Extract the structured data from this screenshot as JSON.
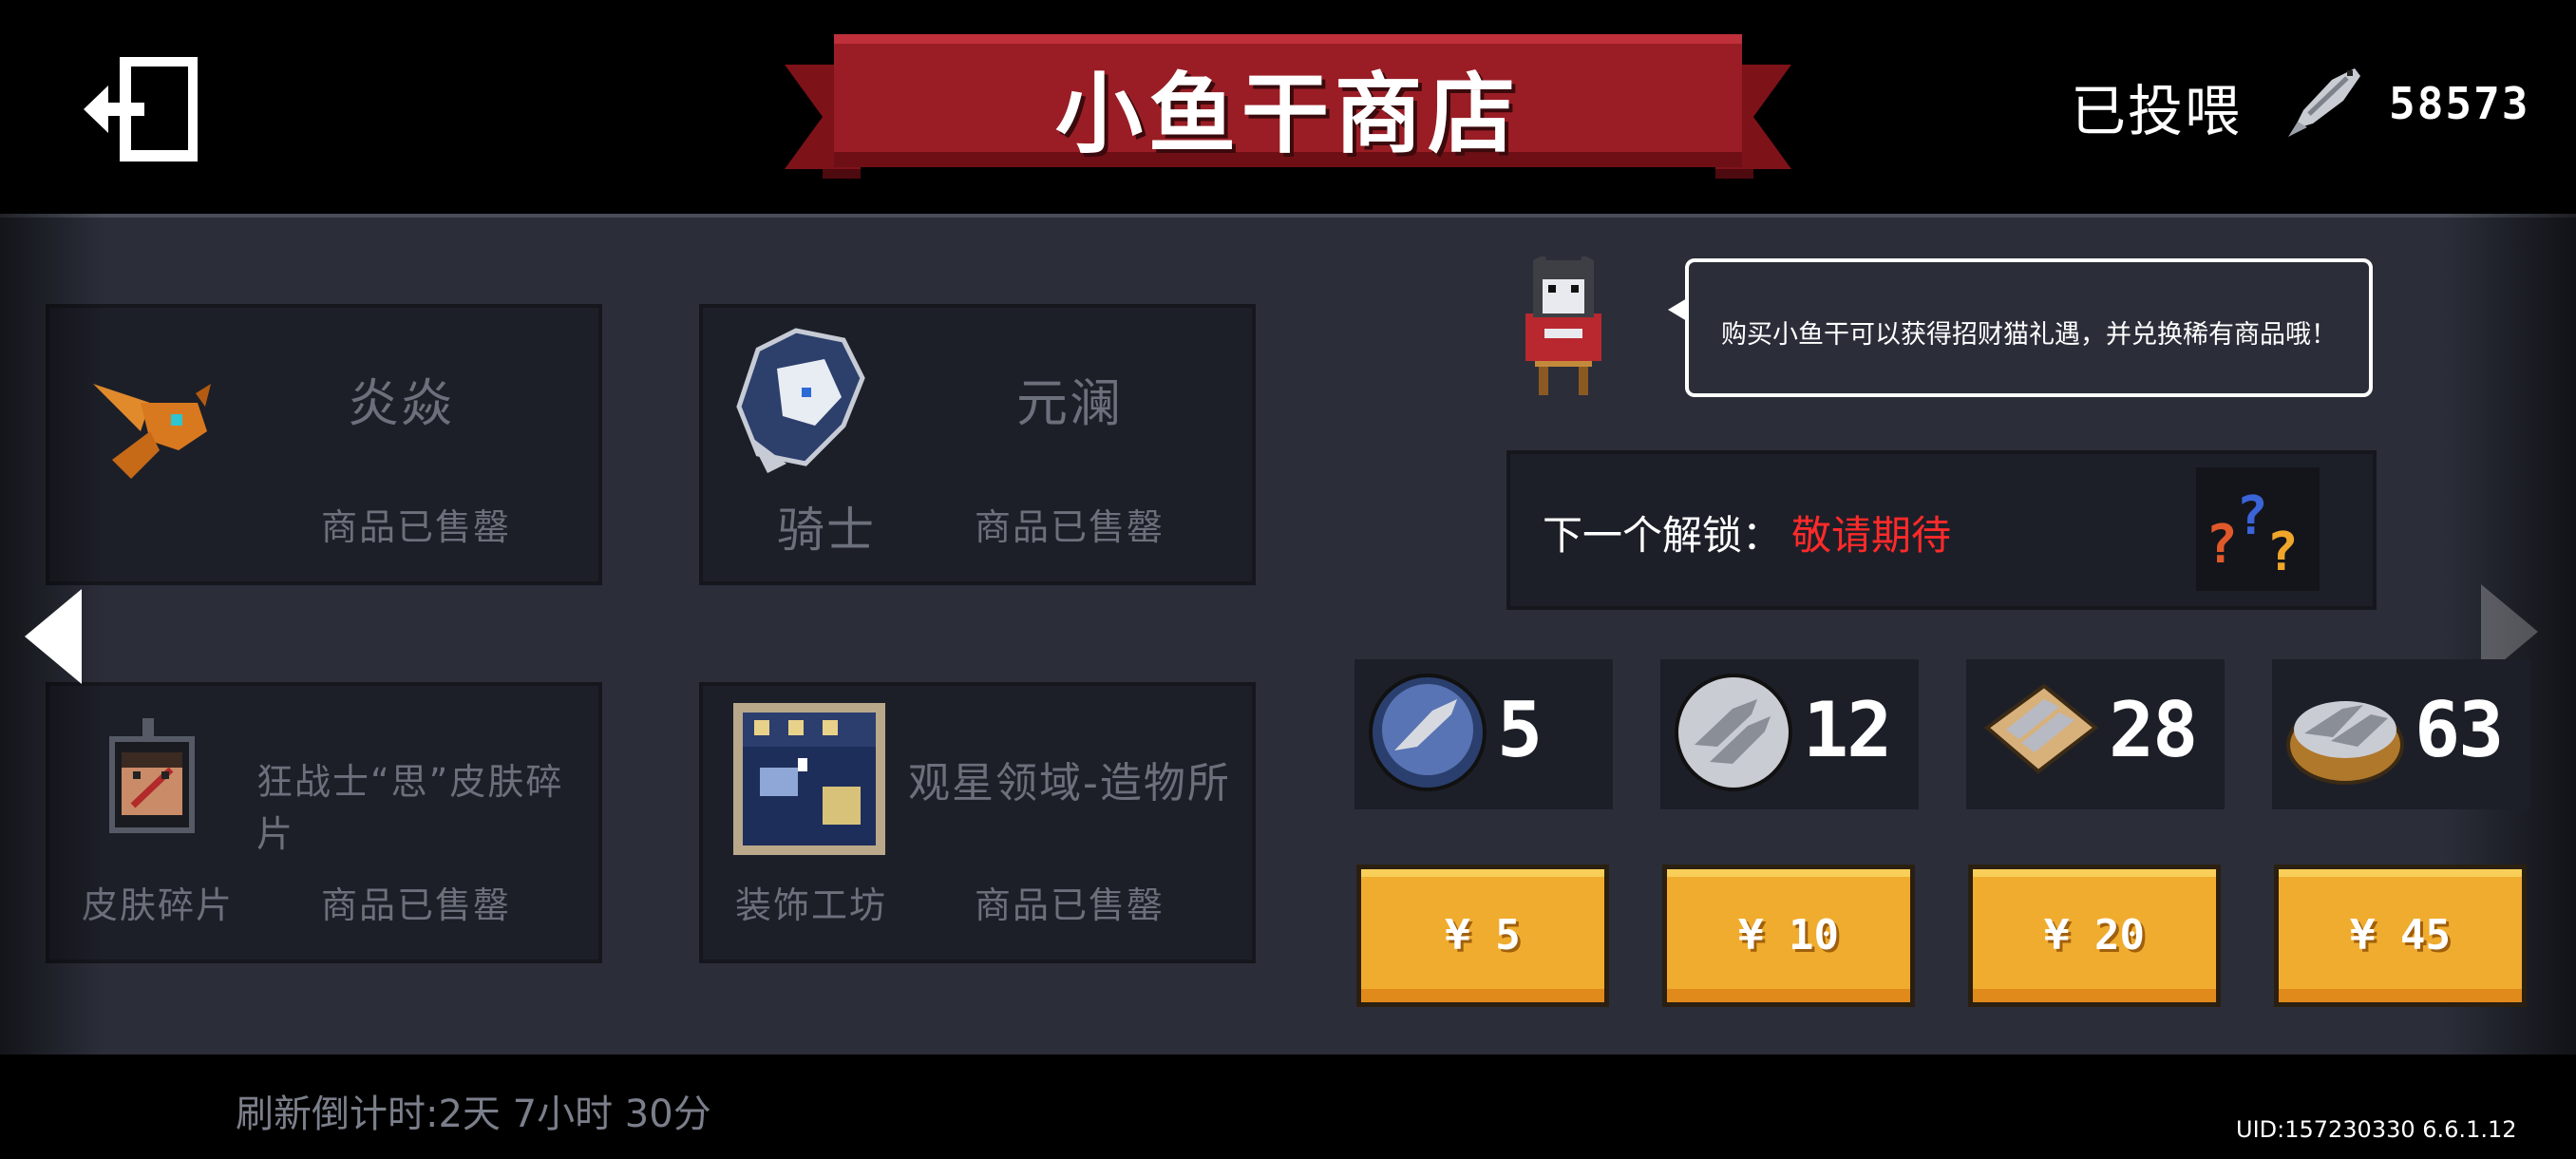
{
  "header": {
    "title": "小鱼干商店",
    "fed_label": "已投喂",
    "fed_count": "58573",
    "fish_icon": "dried-fish-icon",
    "exit_icon": "exit-door-icon"
  },
  "shop_items": [
    {
      "name": "炎焱",
      "category": "",
      "status": "商品已售罄",
      "icon": "orange-dragon-pet-icon"
    },
    {
      "name": "元澜",
      "category": "骑士",
      "status": "商品已售罄",
      "icon": "knight-skin-yuanlan-icon"
    },
    {
      "name": "狂战士“思”皮肤碎片",
      "category": "皮肤碎片",
      "status": "商品已售罄",
      "icon": "berserker-skin-fragment-icon"
    },
    {
      "name": "观星领域-造物所",
      "category": "装饰工坊",
      "status": "商品已售罄",
      "icon": "stargazing-workshop-icon"
    }
  ],
  "cat_speech": "购买小鱼干可以获得招财猫礼遇，并兑换稀有商品哦！",
  "next_unlock": {
    "label": "下一个解锁：",
    "value": "敬请期待",
    "icon": "question-marks-icon"
  },
  "fish_packs": [
    {
      "quantity": "5",
      "price": "¥ 5",
      "icon": "fish-plate-icon"
    },
    {
      "quantity": "12",
      "price": "¥ 10",
      "icon": "fish-pile-plate-icon"
    },
    {
      "quantity": "28",
      "price": "¥ 20",
      "icon": "fish-tray-icon"
    },
    {
      "quantity": "63",
      "price": "¥ 45",
      "icon": "fish-basket-icon"
    }
  ],
  "footer": {
    "countdown": "刷新倒计时:2天 7小时 30分",
    "uid": "UID:157230330 6.6.1.12"
  },
  "colors": {
    "background": "#000000",
    "panel": "#2b2e39",
    "card": "#1d1f28",
    "banner_red": "#9a1d25",
    "unlock_red": "#ff2a2a",
    "buy_button": "#f0ac2e",
    "muted_text": "#6c707c"
  }
}
